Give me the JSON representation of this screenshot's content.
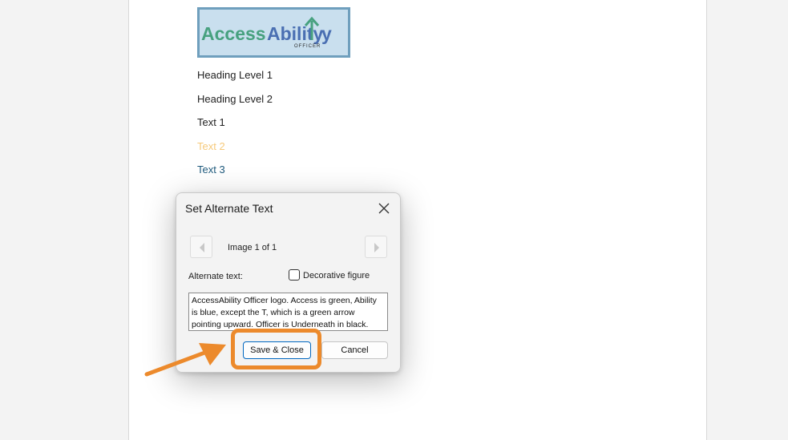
{
  "document": {
    "logo": {
      "word_access": "Access",
      "word_ability": "Ability",
      "tagline": "OFFICER"
    },
    "lines": {
      "heading1": "Heading Level 1",
      "heading2": "Heading Level 2",
      "text1": "Text 1",
      "text2": "Text 2",
      "text3": "Text 3"
    }
  },
  "dialog": {
    "title": "Set Alternate Text",
    "close_icon": "close-icon",
    "image_counter": "Image 1 of 1",
    "prev_icon": "chevron-left-icon",
    "next_icon": "chevron-right-icon",
    "alt_text_label": "Alternate text:",
    "decorative_label": "Decorative figure",
    "decorative_checked": false,
    "alt_text_value": "AccessAbility Officer logo. Access is green, Ability is blue, except the T, which is a green arrow pointing upward. Officer is Underneath in black.",
    "save_close_label": "Save & Close",
    "cancel_label": "Cancel"
  },
  "annotation": {
    "highlight_color": "#ec8a2c",
    "pointer_icon": "arrow-icon"
  }
}
